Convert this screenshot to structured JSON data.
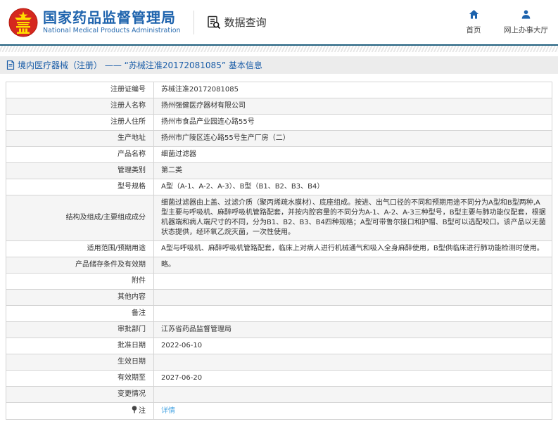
{
  "header": {
    "org_name_cn": "国家药品监督管理局",
    "org_name_en": "National Medical Products Administration",
    "data_query_label": "数据查询",
    "nav": [
      {
        "label": "首页",
        "icon": "home-icon"
      },
      {
        "label": "网上办事大厅",
        "icon": "user-icon"
      }
    ]
  },
  "breadcrumb": {
    "text": "境内医疗器械（注册） —— “苏械注准20172081085” 基本信息",
    "icon": "document-icon"
  },
  "colors": {
    "brand_blue": "#1e63ad",
    "teal_line": "#20607f",
    "link_blue": "#4aa6e3",
    "emblem_red": "#d5281e",
    "emblem_yellow": "#ffde00",
    "row_alt_bg": "#f5f5f5"
  },
  "table": {
    "rows": [
      {
        "label": "注册证编号",
        "value": "苏械注准20172081085"
      },
      {
        "label": "注册人名称",
        "value": "扬州强健医疗器材有限公司"
      },
      {
        "label": "注册人住所",
        "value": "扬州市食品产业园连心路55号"
      },
      {
        "label": "生产地址",
        "value": "扬州市广陵区连心路55号生产厂房（二）"
      },
      {
        "label": "产品名称",
        "value": "细菌过滤器"
      },
      {
        "label": "管理类别",
        "value": "第二类"
      },
      {
        "label": "型号规格",
        "value": "A型（A-1、A-2、A-3）、B型（B1、B2、B3、B4）"
      },
      {
        "label": "结构及组成/主要组成成分",
        "value": "细菌过滤器由上盖、过滤介质（聚丙烯疏水膜材）、底座组成。按进、出气口径的不同和预期用途不同分为A型和B型两种,A型主要与呼吸机、麻醉呼吸机管路配套，并按内腔容量的不同分为A-1、A-2、A-3三种型号，B型主要与肺功能仪配套，根据机器端和病人端尺寸的不同，分为B1、B2、B3、B4四种规格；A型可带鲁尔接口和护帽、B型可以选配咬口。该产品以无菌状态提供，经环氧乙烷灭菌，一次性使用。"
      },
      {
        "label": "适用范围/预期用途",
        "value": "A型与呼吸机、麻醉呼吸机管路配套，临床上对病人进行机械通气和吸入全身麻醉使用，B型供临床进行肺功能检测时使用。"
      },
      {
        "label": "产品储存条件及有效期",
        "value": "略。"
      },
      {
        "label": "附件",
        "value": ""
      },
      {
        "label": "其他内容",
        "value": ""
      },
      {
        "label": "备注",
        "value": ""
      },
      {
        "label": "审批部门",
        "value": "江苏省药品监督管理局"
      },
      {
        "label": "批准日期",
        "value": "2022-06-10"
      },
      {
        "label": "生效日期",
        "value": ""
      },
      {
        "label": "有效期至",
        "value": "2027-06-20"
      },
      {
        "label": "变更情况",
        "value": ""
      },
      {
        "label": "注",
        "value": "详情",
        "value_is_link": true,
        "label_icon": "pin-note-icon"
      }
    ]
  }
}
